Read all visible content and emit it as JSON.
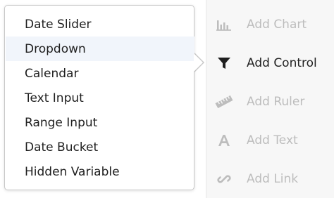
{
  "dropdown_menu": {
    "items": [
      {
        "label": "Date Slider",
        "selected": false
      },
      {
        "label": "Dropdown",
        "selected": true
      },
      {
        "label": "Calendar",
        "selected": false
      },
      {
        "label": "Text Input",
        "selected": false
      },
      {
        "label": "Range Input",
        "selected": false
      },
      {
        "label": "Date Bucket",
        "selected": false
      },
      {
        "label": "Hidden Variable",
        "selected": false
      }
    ]
  },
  "toolbar": {
    "items": [
      {
        "label": "Add Chart",
        "icon": "bar-chart-icon",
        "active": false
      },
      {
        "label": "Add Control",
        "icon": "filter-funnel-icon",
        "active": true
      },
      {
        "label": "Add Ruler",
        "icon": "ruler-icon",
        "active": false
      },
      {
        "label": "Add Text",
        "icon": "text-a-icon",
        "active": false
      },
      {
        "label": "Add Link",
        "icon": "link-chain-icon",
        "active": false
      }
    ]
  },
  "colors": {
    "selected_row": "#f1f5fb",
    "active_text": "#222222",
    "inactive_text": "#bdbdbd",
    "toolbar_bg": "#f7f7f7"
  }
}
